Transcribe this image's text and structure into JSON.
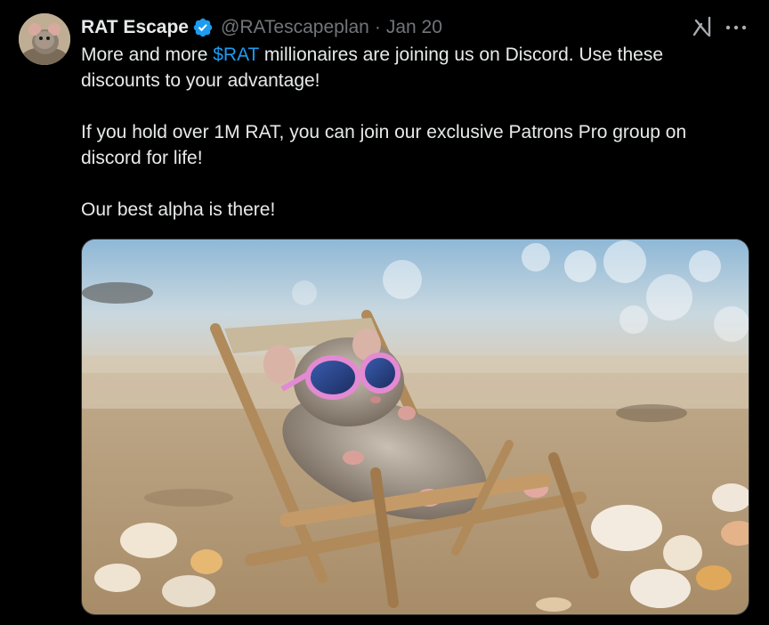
{
  "author": {
    "display_name": "RAT Escape",
    "handle": "@RATescapeplan",
    "separator": "·",
    "date": "Jan 20",
    "verified": true,
    "avatar_icon": "rat-avatar"
  },
  "header_icons": {
    "grok": "grok-icon",
    "more": "more-options-icon"
  },
  "text": {
    "line1_before": "More and more ",
    "cashtag": "$RAT",
    "line1_after": " millionaires are joining us on Discord. Use these discounts to your advantage!",
    "paragraph2": "If you hold over 1M RAT, you can join our exclusive Patrons Pro group on discord for life!",
    "paragraph3": "Our best alpha is there!"
  },
  "media": {
    "icon": "rat-on-beach-chair-image"
  },
  "colors": {
    "background": "#000000",
    "text": "#e7e9ea",
    "muted": "#71767b",
    "link": "#1d9bf0",
    "verified": "#1d9bf0"
  }
}
